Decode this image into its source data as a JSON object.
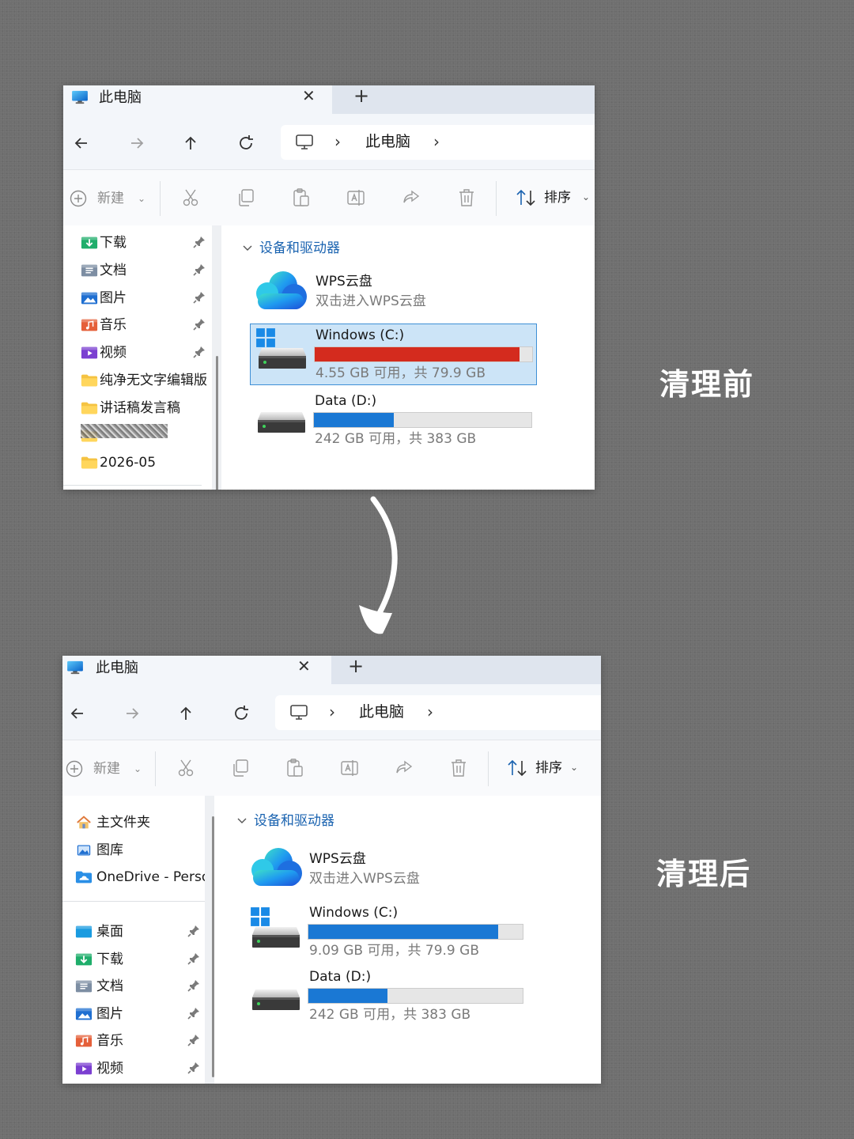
{
  "before": {
    "caption": "清理前",
    "window": {
      "tab_title": "此电脑",
      "address": "此电脑",
      "toolbar": {
        "new_label": "新建",
        "sort_label": "排序"
      },
      "sidebar": [
        {
          "label": "下载",
          "icon": "downloads-folder-icon",
          "pinned": true
        },
        {
          "label": "文档",
          "icon": "documents-folder-icon",
          "pinned": true
        },
        {
          "label": "图片",
          "icon": "pictures-folder-icon",
          "pinned": true
        },
        {
          "label": "音乐",
          "icon": "music-folder-icon",
          "pinned": true
        },
        {
          "label": "视频",
          "icon": "videos-folder-icon",
          "pinned": true
        },
        {
          "label": "纯净无文字编辑版",
          "icon": "folder-icon",
          "pinned": false
        },
        {
          "label": "讲话稿发言稿",
          "icon": "folder-icon",
          "pinned": false
        },
        {
          "label": "",
          "icon": "folder-icon",
          "pinned": false
        },
        {
          "label": "2026-05",
          "icon": "folder-icon",
          "pinned": false
        }
      ],
      "group_label": "设备和驱动器",
      "wps": {
        "name": "WPS云盘",
        "subtitle": "双击进入WPS云盘"
      },
      "drives": [
        {
          "name": "Windows (C:)",
          "space": "4.55 GB 可用，共 79.9 GB",
          "used_fraction": 0.943,
          "bar_color": "#d42b1e",
          "selected": true
        },
        {
          "name": "Data (D:)",
          "space": "242 GB 可用，共 383 GB",
          "used_fraction": 0.368,
          "bar_color": "#1a78d4",
          "selected": false
        }
      ]
    }
  },
  "after": {
    "caption": "清理后",
    "window": {
      "tab_title": "此电脑",
      "address": "此电脑",
      "toolbar": {
        "new_label": "新建",
        "sort_label": "排序"
      },
      "sidebar_top": [
        {
          "label": "主文件夹",
          "icon": "home-icon"
        },
        {
          "label": "图库",
          "icon": "gallery-icon"
        },
        {
          "label": "OneDrive - Perso",
          "icon": "onedrive-icon"
        }
      ],
      "sidebar": [
        {
          "label": "桌面",
          "icon": "desktop-folder-icon",
          "pinned": true
        },
        {
          "label": "下载",
          "icon": "downloads-folder-icon",
          "pinned": true
        },
        {
          "label": "文档",
          "icon": "documents-folder-icon",
          "pinned": true
        },
        {
          "label": "图片",
          "icon": "pictures-folder-icon",
          "pinned": true
        },
        {
          "label": "音乐",
          "icon": "music-folder-icon",
          "pinned": true
        },
        {
          "label": "视频",
          "icon": "videos-folder-icon",
          "pinned": true
        }
      ],
      "group_label": "设备和驱动器",
      "wps": {
        "name": "WPS云盘",
        "subtitle": "双击进入WPS云盘"
      },
      "drives": [
        {
          "name": "Windows (C:)",
          "space": "9.09 GB 可用，共 79.9 GB",
          "used_fraction": 0.886,
          "bar_color": "#1a78d4",
          "selected": false
        },
        {
          "name": "Data (D:)",
          "space": "242 GB 可用，共 383 GB",
          "used_fraction": 0.368,
          "bar_color": "#1a78d4",
          "selected": false
        }
      ]
    }
  }
}
